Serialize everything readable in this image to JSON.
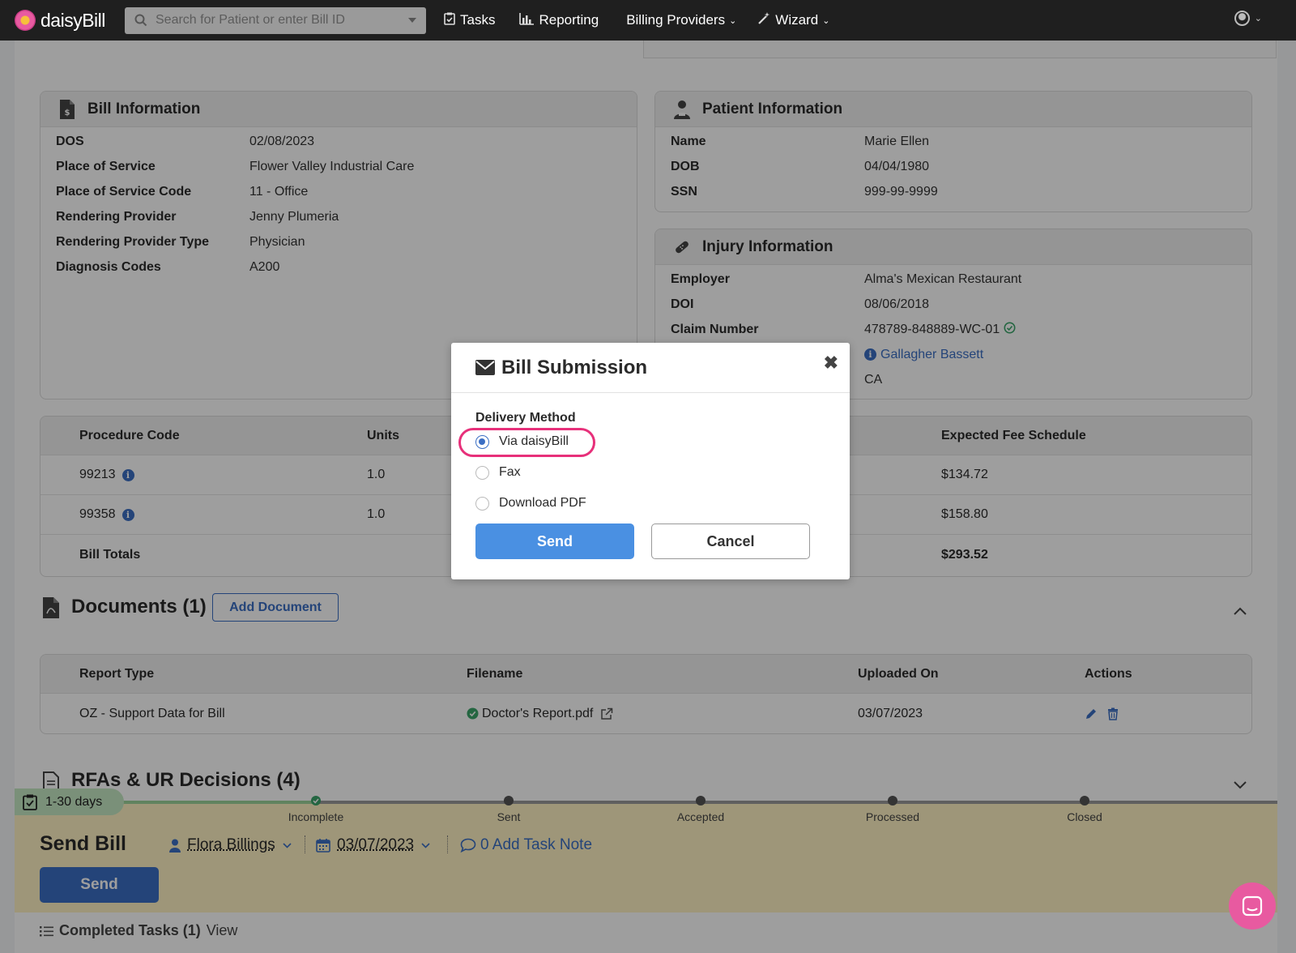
{
  "nav": {
    "brand": "daisyBill",
    "search_placeholder": "Search for Patient or enter Bill ID",
    "items": [
      {
        "label": "Tasks",
        "icon": "clipboard-check-icon"
      },
      {
        "label": "Reporting",
        "icon": "bar-chart-icon"
      },
      {
        "label": "Billing Providers",
        "icon": "chevron-down-icon"
      },
      {
        "label": "Wizard",
        "icon": "magic-wand-icon"
      }
    ]
  },
  "bill_info": {
    "title": "Bill Information",
    "rows": [
      {
        "k": "DOS",
        "v": "02/08/2023"
      },
      {
        "k": "Place of Service",
        "v": "Flower Valley Industrial Care"
      },
      {
        "k": "Place of Service Code",
        "v": "11 - Office"
      },
      {
        "k": "Rendering Provider",
        "v": "Jenny Plumeria"
      },
      {
        "k": "Rendering Provider Type",
        "v": "Physician"
      },
      {
        "k": "Diagnosis Codes",
        "v": "A200"
      }
    ]
  },
  "patient_info": {
    "title": "Patient Information",
    "rows": [
      {
        "k": "Name",
        "v": "Marie Ellen"
      },
      {
        "k": "DOB",
        "v": "04/04/1980"
      },
      {
        "k": "SSN",
        "v": "999-99-9999"
      }
    ]
  },
  "injury_info": {
    "title": "Injury Information",
    "rows": [
      {
        "k": "Employer",
        "v": "Alma's Mexican Restaurant"
      },
      {
        "k": "DOI",
        "v": "08/06/2018"
      },
      {
        "k": "Claim Number",
        "v": "478789-848889-WC-01"
      }
    ],
    "insurer": "Gallagher Bassett",
    "state": "CA"
  },
  "procedures": {
    "headers": {
      "code": "Procedure Code",
      "units": "Units",
      "fee": "Expected Fee Schedule"
    },
    "rows": [
      {
        "code": "99213",
        "units": "1.0",
        "fee": "$134.72"
      },
      {
        "code": "99358",
        "units": "1.0",
        "fee": "$158.80"
      }
    ],
    "totals_label": "Bill Totals",
    "totals_value": "$293.52"
  },
  "documents": {
    "title": "Documents (1)",
    "add_button": "Add Document",
    "headers": {
      "type": "Report Type",
      "filename": "Filename",
      "uploaded": "Uploaded On",
      "actions": "Actions"
    },
    "rows": [
      {
        "type": "OZ - Support Data for Bill",
        "filename": "Doctor's Report.pdf",
        "uploaded": "03/07/2023"
      }
    ]
  },
  "rfas": {
    "title": "RFAs & UR Decisions (4)"
  },
  "task": {
    "age_pill": "1-30 days",
    "stages": [
      "Incomplete",
      "Sent",
      "Accepted",
      "Processed",
      "Closed"
    ],
    "current_stage": "Incomplete",
    "title": "Send Bill",
    "assignee": "Flora Billings",
    "due_date": "03/07/2023",
    "note_link": "0 Add Task Note",
    "send_button": "Send",
    "completed_tasks": "Completed Tasks (1)",
    "view_link": "View"
  },
  "modal": {
    "title": "Bill Submission",
    "delivery_label": "Delivery Method",
    "options": [
      {
        "label": "Via daisyBill",
        "selected": true
      },
      {
        "label": "Fax",
        "selected": false
      },
      {
        "label": "Download PDF",
        "selected": false
      }
    ],
    "send": "Send",
    "cancel": "Cancel"
  },
  "colors": {
    "accent": "#4a90e2",
    "link": "#3b6fc4",
    "highlight": "#e7307a",
    "success": "#3aa56a",
    "task_bg": "#fff3c4",
    "nav_bg": "#1f1f1f"
  }
}
